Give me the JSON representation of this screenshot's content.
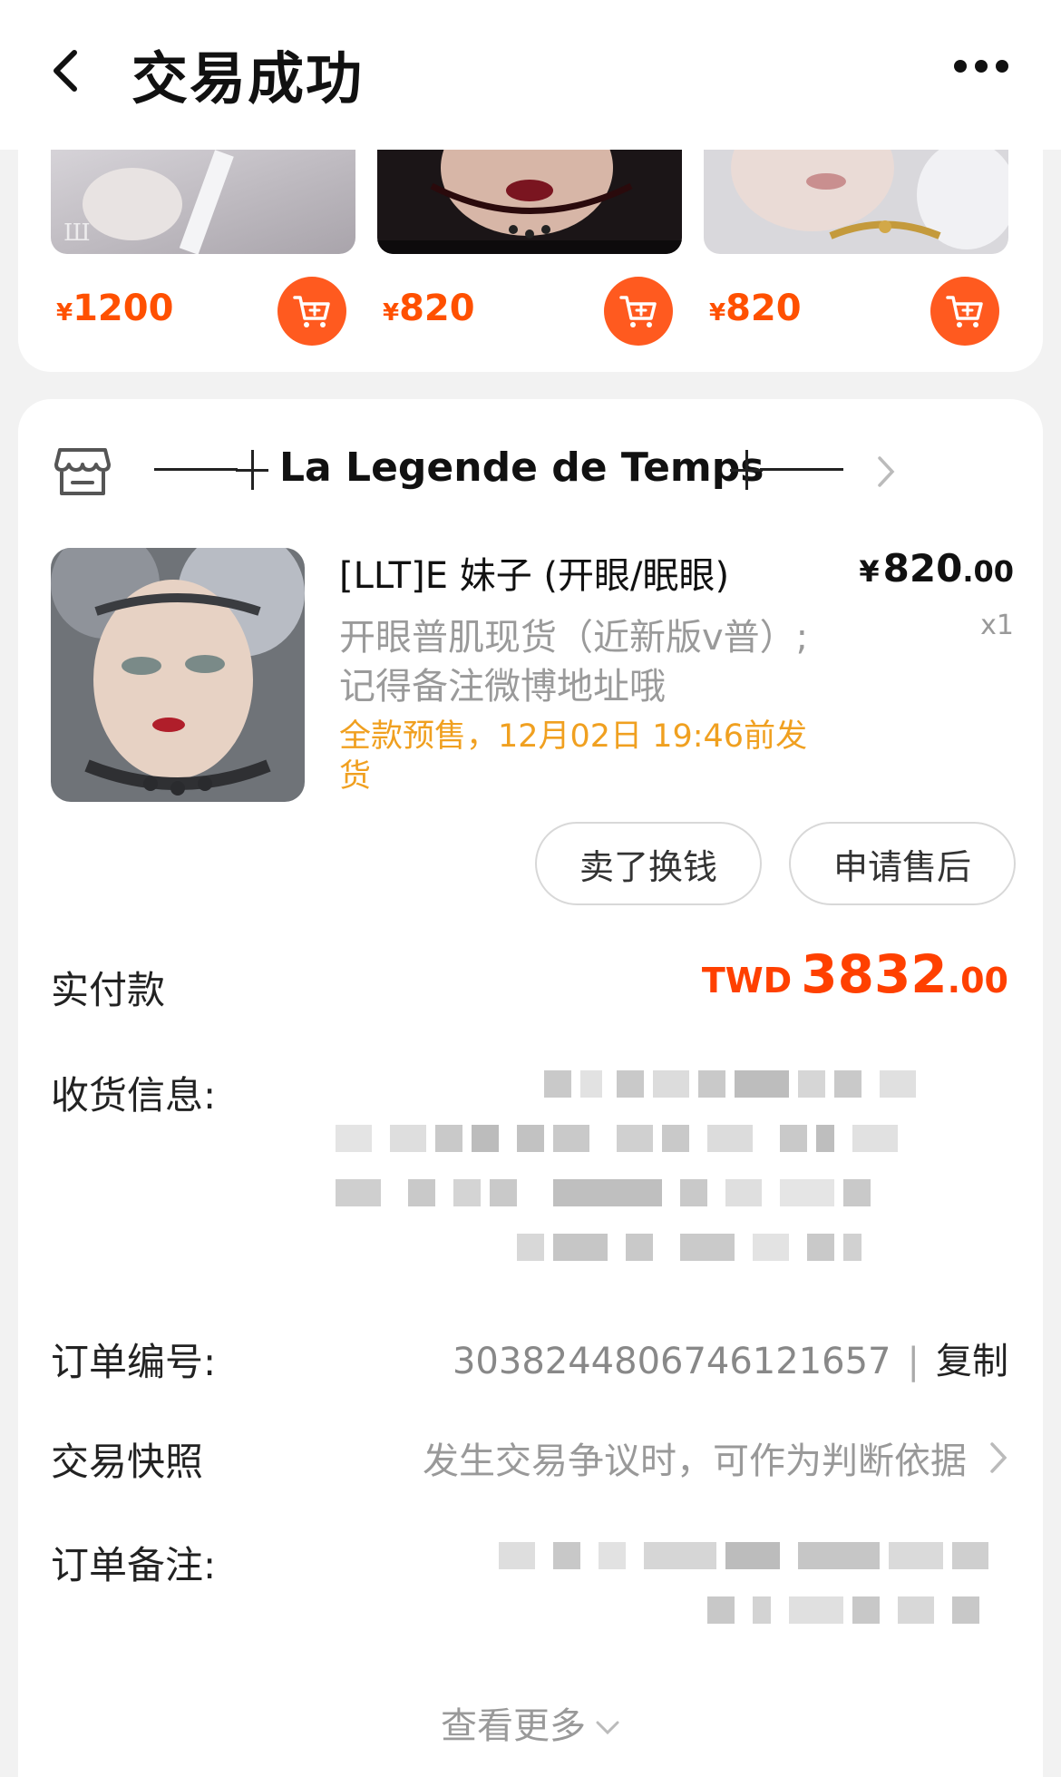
{
  "header": {
    "title": "交易成功"
  },
  "recommendations": [
    {
      "currency": "¥",
      "price": "1200"
    },
    {
      "currency": "¥",
      "price": "820"
    },
    {
      "currency": "¥",
      "price": "820"
    }
  ],
  "shop": {
    "name": "La Legende de Temps"
  },
  "product": {
    "title": "[LLT]E 妹子 (开眼/眠眼)",
    "price_symbol": "¥",
    "price_int": "820",
    "price_dec": ".00",
    "quantity": "x1",
    "spec": "开眼普肌现货（近新版v普）;记得备注微博地址哦",
    "shipping": "全款预售，12月02日 19:46前发货"
  },
  "actions": {
    "sell_label": "卖了换钱",
    "aftersale_label": "申请售后"
  },
  "payment": {
    "label": "实付款",
    "currency": "TWD",
    "amount_int": "3832",
    "amount_dec": ".00"
  },
  "shipping_info": {
    "label": "收货信息:"
  },
  "order_number": {
    "label": "订单编号:",
    "value": "3038244806746121657",
    "separator": "|",
    "copy_label": "复制"
  },
  "snapshot": {
    "label": "交易快照",
    "hint": "发生交易争议时，可作为判断依据"
  },
  "order_note": {
    "label": "订单备注:"
  },
  "footer": {
    "view_more": "查看更多"
  },
  "colors": {
    "accent": "#ff5000",
    "shipping_text": "#f0a020",
    "payment": "#ff4000"
  }
}
